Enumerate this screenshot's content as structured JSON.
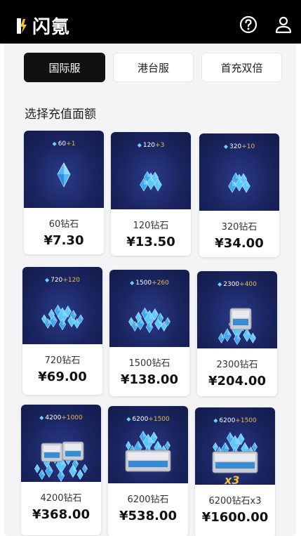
{
  "header": {
    "logo_text": "闪氪",
    "help_icon": "question-circle-icon",
    "user_icon": "user-icon"
  },
  "tabs": [
    {
      "label": "国际服",
      "active": true
    },
    {
      "label": "港台服",
      "active": false
    },
    {
      "label": "首充双倍",
      "active": false
    }
  ],
  "section_title": "选择充值面额",
  "products": [
    {
      "base": "60",
      "bonus": "+1",
      "name": "60钻石",
      "price": "¥7.30",
      "art": "single-diamond"
    },
    {
      "base": "120",
      "bonus": "+3",
      "name": "120钻石",
      "price": "¥13.50",
      "art": "small-pile"
    },
    {
      "base": "320",
      "bonus": "+10",
      "name": "320钻石",
      "price": "¥34.00",
      "art": "small-pile"
    },
    {
      "base": "720",
      "bonus": "+120",
      "name": "720钻石",
      "price": "¥69.00",
      "art": "large-pile"
    },
    {
      "base": "1500",
      "bonus": "+260",
      "name": "1500钻石",
      "price": "¥138.00",
      "art": "large-pile"
    },
    {
      "base": "2300",
      "bonus": "+400",
      "name": "2300钻石",
      "price": "¥204.00",
      "art": "chest"
    },
    {
      "base": "4200",
      "bonus": "+1000",
      "name": "4200钻石",
      "price": "¥368.00",
      "art": "two-chests"
    },
    {
      "base": "6200",
      "bonus": "+1500",
      "name": "6200钻石",
      "price": "¥538.00",
      "art": "big-chest"
    },
    {
      "base": "6200",
      "bonus": "+1500",
      "name": "6200钻石x3",
      "price": "¥1600.00",
      "art": "big-chest-x3",
      "multiplier": "x3"
    }
  ],
  "colors": {
    "topbar": "#000000",
    "active_tab": "#111111",
    "card_art_bg": "#1a2560",
    "bonus_accent": "#f0b84a",
    "diamond": "#4fb6ff"
  }
}
